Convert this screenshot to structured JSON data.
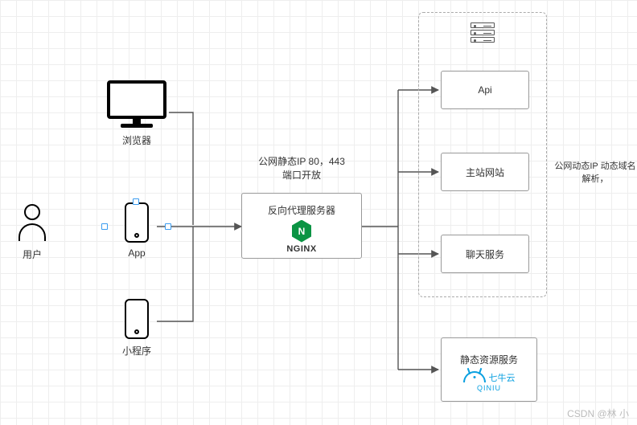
{
  "user": {
    "label": "用户"
  },
  "clients": {
    "browser": {
      "label": "浏览器"
    },
    "app": {
      "label": "App"
    },
    "miniprogram": {
      "label": "小程序"
    }
  },
  "proxy": {
    "note_line1": "公网静态IP 80，443",
    "note_line2": "端口开放",
    "title": "反向代理服务器",
    "engine": "NGINX"
  },
  "cluster": {
    "note_line1": "公网动态IP 动态域名",
    "note_line2": "解析，",
    "services": {
      "api": "Api",
      "site": "主站网站",
      "chat": "聊天服务"
    }
  },
  "static": {
    "title": "静态资源服务",
    "provider_cn": "七牛云",
    "provider_en": "QINIU"
  },
  "watermark": "CSDN @林 小"
}
